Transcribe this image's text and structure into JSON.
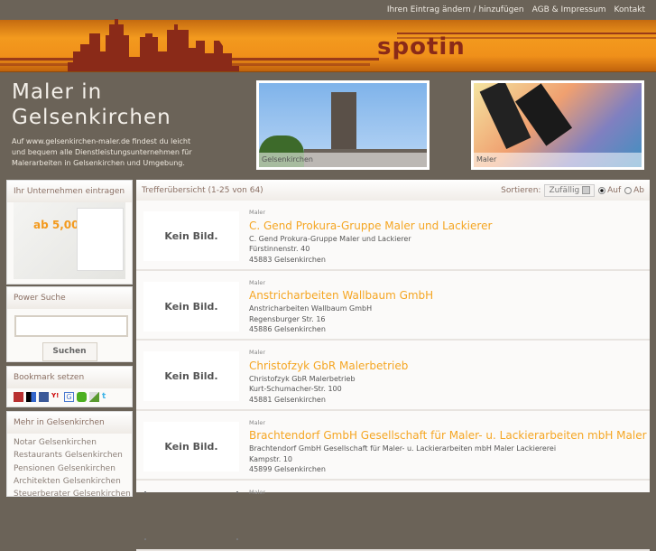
{
  "topnav": [
    "Ihren Eintrag ändern / hinzufügen",
    "AGB & Impressum",
    "Kontakt"
  ],
  "logo": "spotin",
  "header": {
    "title_line1": "Maler in",
    "title_line2": "Gelsenkirchen",
    "intro": "Auf www.gelsenkirchen-maler.de findest du leicht und bequem alle Dienstleistungsunternehmen für Malerarbeiten in Gelsenkirchen und Umgebung.",
    "photo1_caption": "Gelsenkirchen",
    "photo2_caption": "Maler"
  },
  "sidebar": {
    "register": {
      "title": "Ihr Unternehmen eintragen",
      "promo": "ab 5,00"
    },
    "search": {
      "title": "Power Suche",
      "value": "",
      "button": "Suchen"
    },
    "bookmark": {
      "title": "Bookmark setzen",
      "icons": [
        "mister-wong-icon",
        "delicious-icon",
        "facebook-icon",
        "yahoo-icon",
        "google-icon",
        "linkarena-icon",
        "webnews-icon",
        "twitter-icon"
      ]
    },
    "more": {
      "title": "Mehr in Gelsenkirchen",
      "links": [
        "Notar Gelsenkirchen",
        "Restaurants Gelsenkirchen",
        "Pensionen Gelsenkirchen",
        "Architekten Gelsenkirchen",
        "Steuerberater Gelsenkirchen"
      ]
    }
  },
  "results": {
    "summary": "Trefferübersicht (1-25 von 64)",
    "sort_label": "Sortieren:",
    "sort_value": "Zufällig",
    "asc": "Auf",
    "desc": "Ab",
    "asc_selected": true,
    "no_image": "Kein Bild.",
    "items": [
      {
        "cat": "Maler",
        "name": "C. Gend Prokura-Gruppe Maler und Lackierer",
        "line1": "C. Gend Prokura-Gruppe Maler und Lackierer",
        "street": "Fürstinnenstr. 40",
        "city": "45883 Gelsenkirchen"
      },
      {
        "cat": "Maler",
        "name": "Anstricharbeiten Wallbaum GmbH",
        "line1": "Anstricharbeiten Wallbaum GmbH",
        "street": "Regensburger Str. 16",
        "city": "45886 Gelsenkirchen"
      },
      {
        "cat": "Maler",
        "name": "Christofzyk GbR Malerbetrieb",
        "line1": "Christofzyk GbR Malerbetrieb",
        "street": "Kurt-Schumacher-Str. 100",
        "city": "45881 Gelsenkirchen"
      },
      {
        "cat": "Maler",
        "name": "Brachtendorf GmbH Gesellschaft für Maler- u. Lackierarbeiten mbH Maler Lackierer",
        "line1": "Brachtendorf GmbH Gesellschaft für Maler- u. Lackierarbeiten mbH Maler Lackiererei",
        "street": "Kampstr. 10",
        "city": "45899 Gelsenkirchen"
      },
      {
        "cat": "Maler"
      }
    ]
  }
}
